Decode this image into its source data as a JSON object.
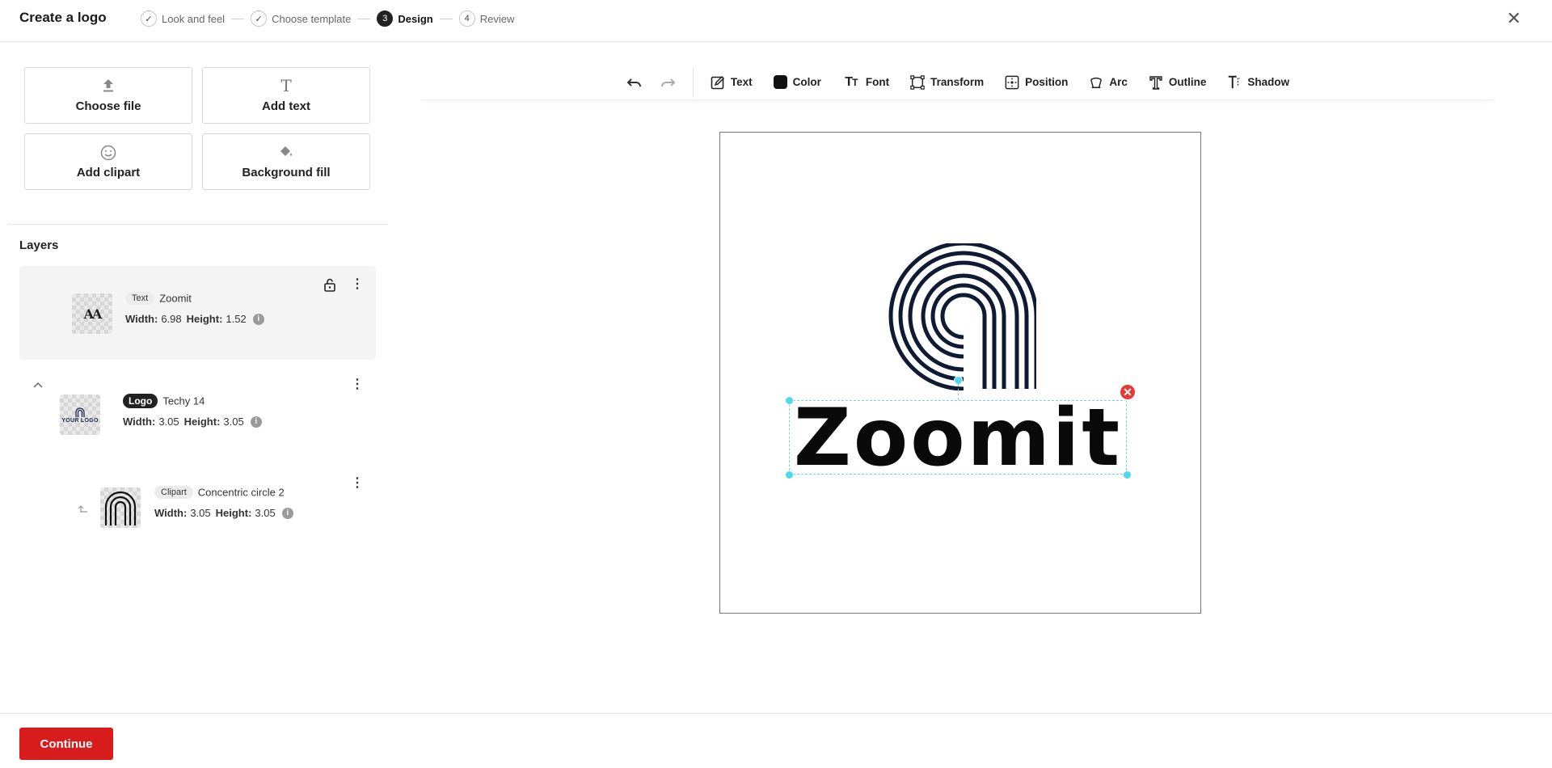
{
  "header": {
    "title": "Create a logo",
    "steps": [
      {
        "marker": "✓",
        "label": "Look and feel"
      },
      {
        "marker": "✓",
        "label": "Choose template"
      },
      {
        "marker": "3",
        "label": "Design"
      },
      {
        "marker": "4",
        "label": "Review"
      }
    ],
    "close_symbol": "✕"
  },
  "tools": {
    "choose_file": "Choose file",
    "add_text": "Add text",
    "add_clipart": "Add clipart",
    "background_fill": "Background fill"
  },
  "layers": {
    "title": "Layers",
    "items": [
      {
        "type_badge": "Text",
        "name": "Zoomit",
        "width_label": "Width:",
        "width": "6.98",
        "height_label": "Height:",
        "height": "1.52",
        "thumb_text": "AA"
      },
      {
        "type_badge": "Logo",
        "name": "Techy 14",
        "width_label": "Width:",
        "width": "3.05",
        "height_label": "Height:",
        "height": "3.05",
        "thumb_text": "YOUR LOGO"
      },
      {
        "type_badge": "Clipart",
        "name": "Concentric circle 2",
        "width_label": "Width:",
        "width": "3.05",
        "height_label": "Height:",
        "height": "3.05"
      }
    ]
  },
  "toolbar": {
    "items": [
      {
        "label": "Text",
        "icon": "edit-icon"
      },
      {
        "label": "Color",
        "icon": "color-swatch"
      },
      {
        "label": "Font",
        "icon": "font-size-icon"
      },
      {
        "label": "Transform",
        "icon": "transform-icon"
      },
      {
        "label": "Position",
        "icon": "position-icon"
      },
      {
        "label": "Arc",
        "icon": "arc-icon"
      },
      {
        "label": "Outline",
        "icon": "outline-icon"
      },
      {
        "label": "Shadow",
        "icon": "shadow-icon"
      }
    ],
    "color_value": "#111111"
  },
  "canvas": {
    "logo_text": "Zoomit",
    "mark_color": "#0f1a33"
  },
  "footer": {
    "continue_label": "Continue",
    "continue_color": "#d81b1b"
  }
}
